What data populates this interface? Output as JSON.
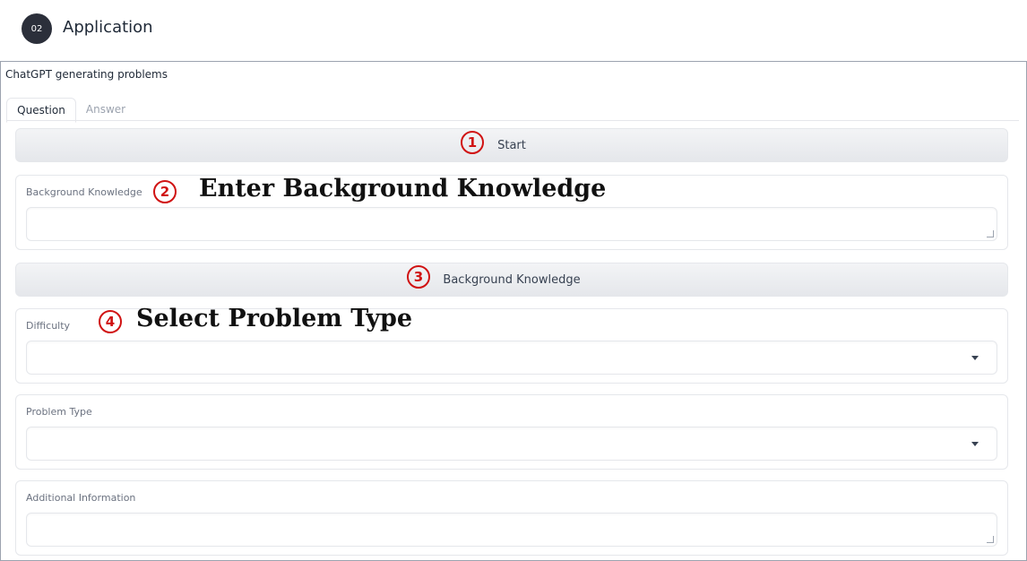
{
  "header": {
    "step": "02",
    "title": "Application"
  },
  "panel": {
    "title": "ChatGPT generating problems"
  },
  "tabs": [
    {
      "label": "Question"
    },
    {
      "label": "Answer"
    }
  ],
  "buttons": {
    "start": "Start",
    "background_knowledge": "Background Knowledge"
  },
  "fields": {
    "background_knowledge": {
      "label": "Background Knowledge",
      "value": ""
    },
    "difficulty": {
      "label": "Difficulty",
      "value": ""
    },
    "problem_type": {
      "label": "Problem Type",
      "value": ""
    },
    "additional_information": {
      "label": "Additional Information",
      "value": ""
    }
  },
  "annotations": {
    "n1": "1",
    "n2": "2",
    "n3": "3",
    "n4": "4",
    "enter_background": "Enter Background Knowledge",
    "select_problem_type": "Select Problem Type"
  },
  "colors": {
    "annotation_red": "#d01212",
    "badge_dark": "#2b2f3a"
  },
  "icons": {
    "select_caret": "chevron-down-icon",
    "resize_handle": "resize-handle-icon"
  }
}
